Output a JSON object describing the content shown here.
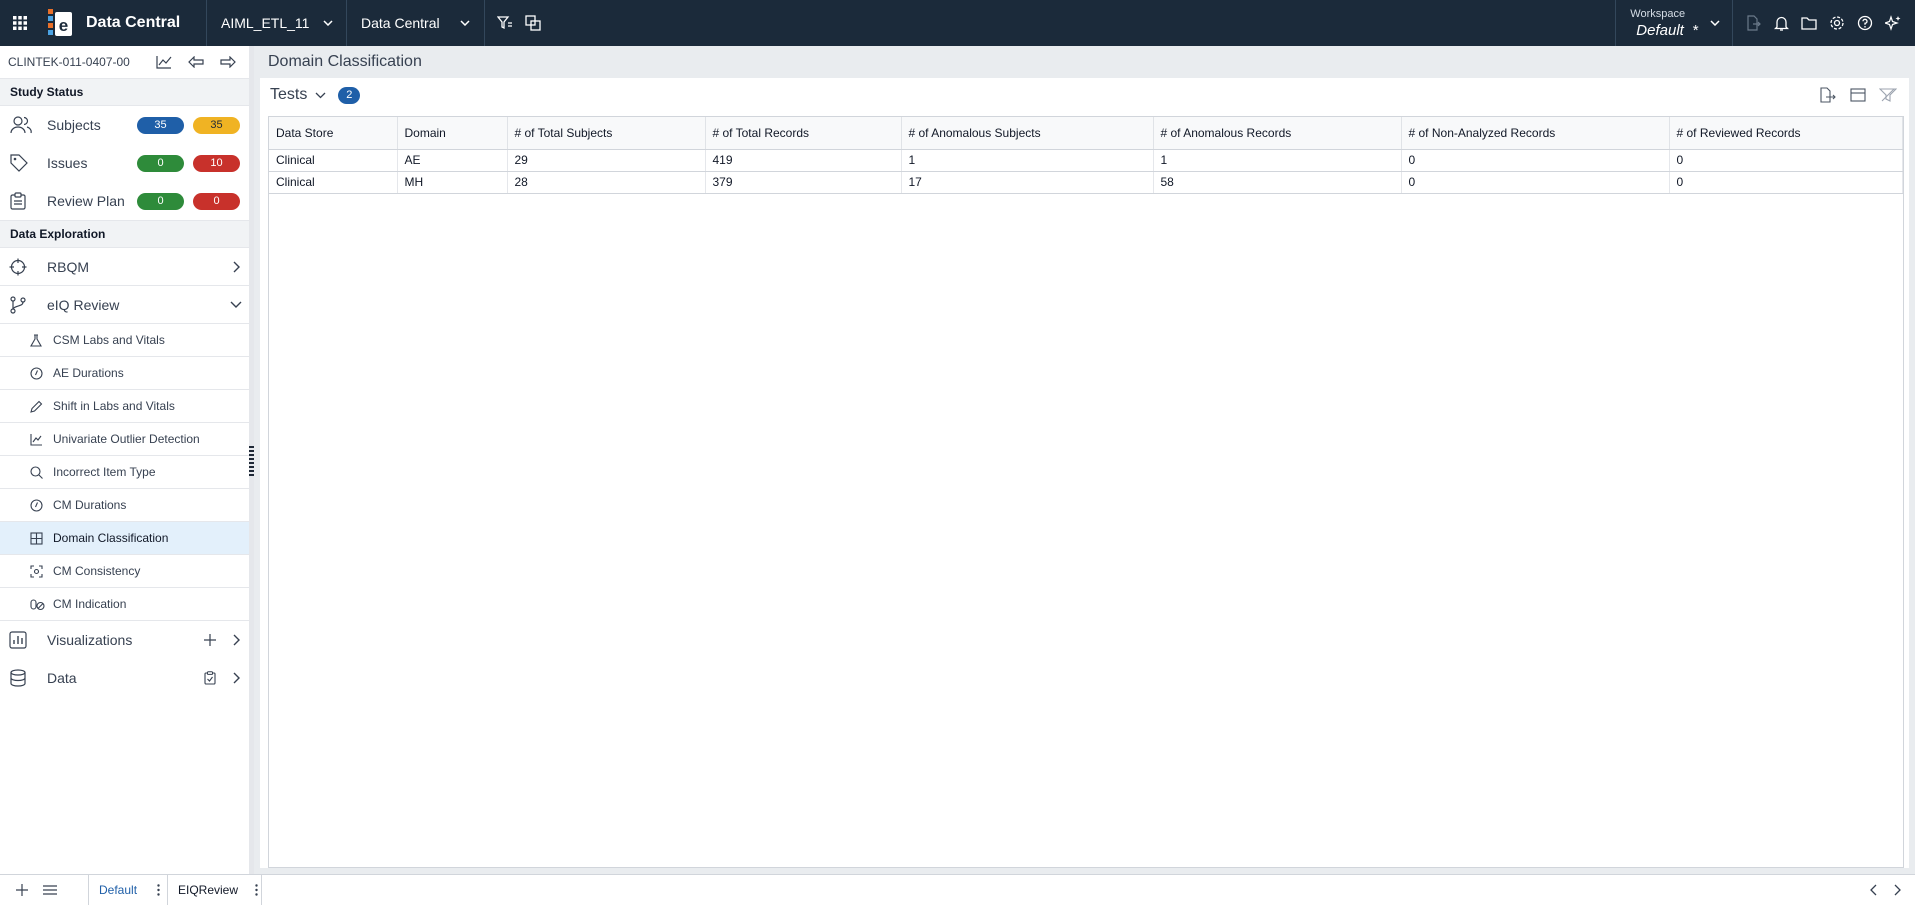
{
  "topbar": {
    "app_title": "Data Central",
    "project_selector": "AIML_ETL_11",
    "module_selector": "Data Central",
    "workspace_label": "Workspace",
    "workspace_value": "Default  *",
    "icons": [
      "apps-grid-icon",
      "logo-icon",
      "filter-tree-icon",
      "compare-icon",
      "export-icon",
      "bell-icon",
      "folder-icon",
      "gear-icon",
      "help-icon",
      "ai-sparkle-icon"
    ]
  },
  "sidebar": {
    "study_id": "CLINTEK-011-0407-00",
    "study_status_heading": "Study Status",
    "status_items": [
      {
        "label": "Subjects",
        "left_badge": "35",
        "right_badge": "35",
        "left_color": "#1f5fa8",
        "right_color": "#f0b323"
      },
      {
        "label": "Issues",
        "left_badge": "0",
        "right_badge": "10",
        "left_color": "#2e8b3a",
        "right_color": "#c8312b"
      },
      {
        "label": "Review Plan",
        "left_badge": "0",
        "right_badge": "0",
        "left_color": "#2e8b3a",
        "right_color": "#c8312b"
      }
    ],
    "data_exploration_heading": "Data Exploration",
    "nav": {
      "rbqm": "RBQM",
      "eiq_review": "eIQ Review",
      "visualizations": "Visualizations",
      "data": "Data"
    },
    "eiq_items": [
      {
        "label": "CSM Labs and Vitals",
        "icon": "flask-icon"
      },
      {
        "label": "AE Durations",
        "icon": "clock-icon"
      },
      {
        "label": "Shift in Labs and Vitals",
        "icon": "pencil-icon"
      },
      {
        "label": "Univariate Outlier Detection",
        "icon": "chart-icon"
      },
      {
        "label": "Incorrect Item Type",
        "icon": "magnifier-icon"
      },
      {
        "label": "CM Durations",
        "icon": "clock-icon"
      },
      {
        "label": "Domain Classification",
        "icon": "table-icon"
      },
      {
        "label": "CM Consistency",
        "icon": "consistency-icon"
      },
      {
        "label": "CM Indication",
        "icon": "pills-icon"
      }
    ],
    "active_item": "Domain Classification"
  },
  "main": {
    "breadcrumb": "Domain Classification",
    "panel_title": "Tests",
    "panel_count": "2",
    "table": {
      "columns": [
        "Data Store",
        "Domain",
        "# of Total Subjects",
        "# of Total Records",
        "# of Anomalous Subjects",
        "# of Anomalous Records",
        "# of Non-Analyzed Records",
        "# of Reviewed Records"
      ],
      "rows": [
        [
          "Clinical",
          "AE",
          "29",
          "419",
          "1",
          "1",
          "0",
          "0"
        ],
        [
          "Clinical",
          "MH",
          "28",
          "379",
          "17",
          "58",
          "0",
          "0"
        ]
      ]
    }
  },
  "bottombar": {
    "tabs": [
      "Default",
      "EIQReview"
    ]
  }
}
